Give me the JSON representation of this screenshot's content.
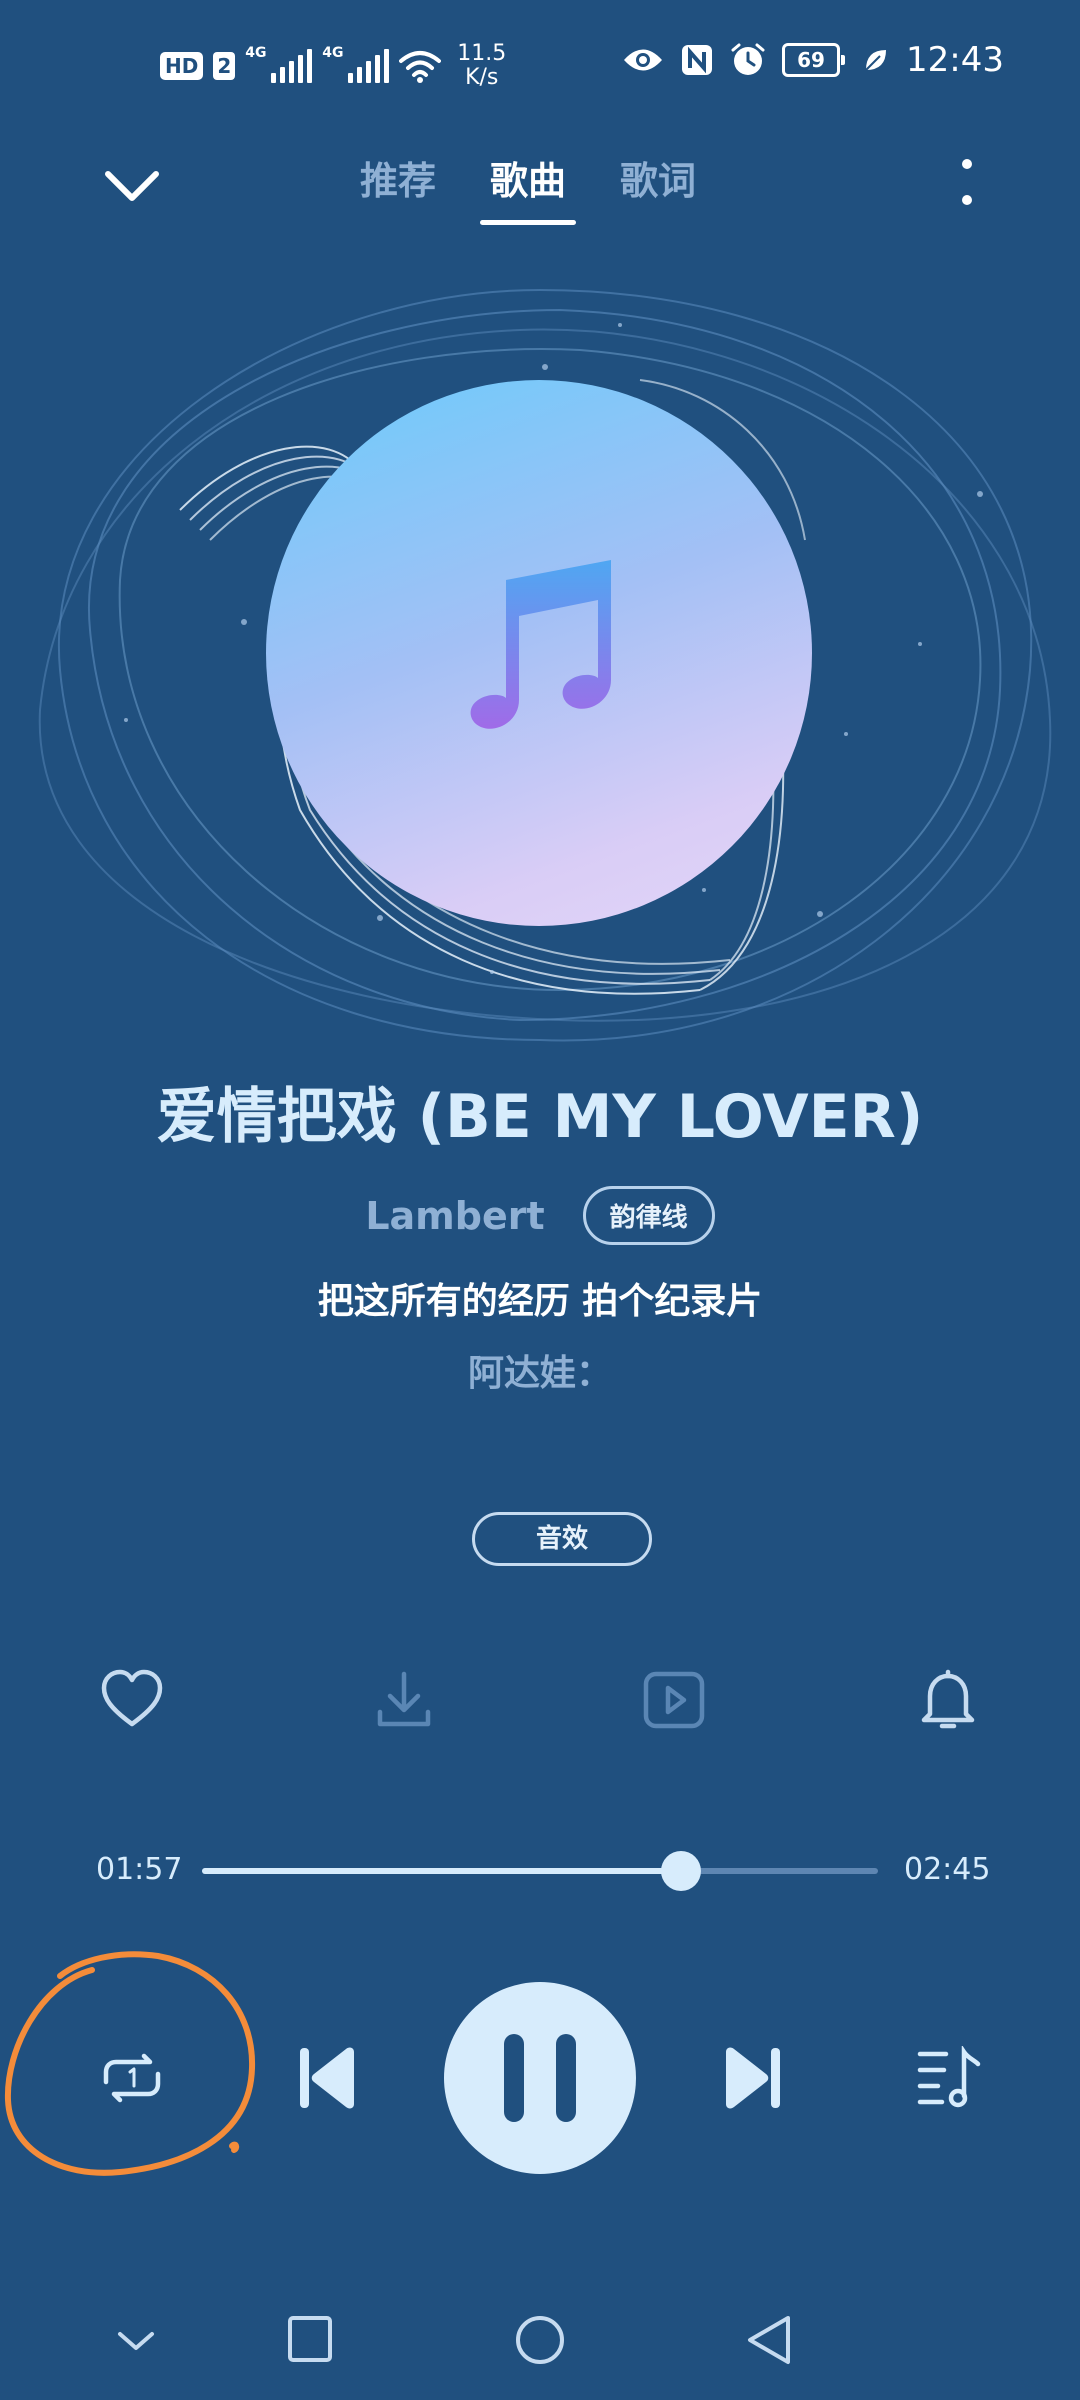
{
  "status_bar": {
    "hd_badge": "HD",
    "sim_badge": "2",
    "network_1": "4G",
    "network_2": "4G",
    "speed_value": "11.5",
    "speed_unit": "K/s",
    "battery_level": "69",
    "time": "12:43",
    "icons": [
      "eye-icon",
      "nfc-icon",
      "alarm-icon",
      "battery-icon",
      "leaf-icon",
      "wifi-icon",
      "signal-icon"
    ]
  },
  "header": {
    "tabs": [
      {
        "label": "推荐",
        "active": false
      },
      {
        "label": "歌曲",
        "active": true
      },
      {
        "label": "歌词",
        "active": false
      }
    ]
  },
  "song": {
    "title": "爱情把戏 (BE MY LOVER)",
    "artist": "Lambert",
    "album_chip": "韵律线",
    "lyric_current": "把这所有的经历 拍个纪录片",
    "lyric_next": "阿达娃："
  },
  "effects_chip": "音效",
  "actions": [
    "heart-icon",
    "download-icon",
    "video-icon",
    "bell-icon"
  ],
  "progress": {
    "elapsed": "01:57",
    "total": "02:45",
    "fraction": 0.709
  },
  "controls": [
    "repeat-one-icon",
    "previous-icon",
    "pause-icon",
    "next-icon",
    "playlist-icon"
  ],
  "colors": {
    "background": "#20507F",
    "accent": "#D7ECFC",
    "muted": "#8FB0D4",
    "annotation": "#F48C3A"
  }
}
